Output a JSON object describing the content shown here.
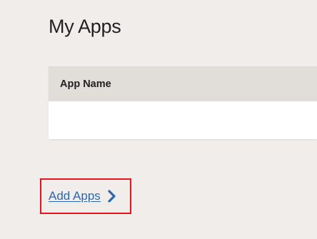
{
  "page": {
    "title": "My Apps"
  },
  "apps_table": {
    "columns": [
      "App Name"
    ],
    "rows": []
  },
  "actions": {
    "add_apps_label": "Add Apps",
    "link_color": "#2968b3",
    "highlight_color": "#e8131c"
  },
  "icons": {
    "add_apps_chevron": "chevron-right-icon"
  }
}
